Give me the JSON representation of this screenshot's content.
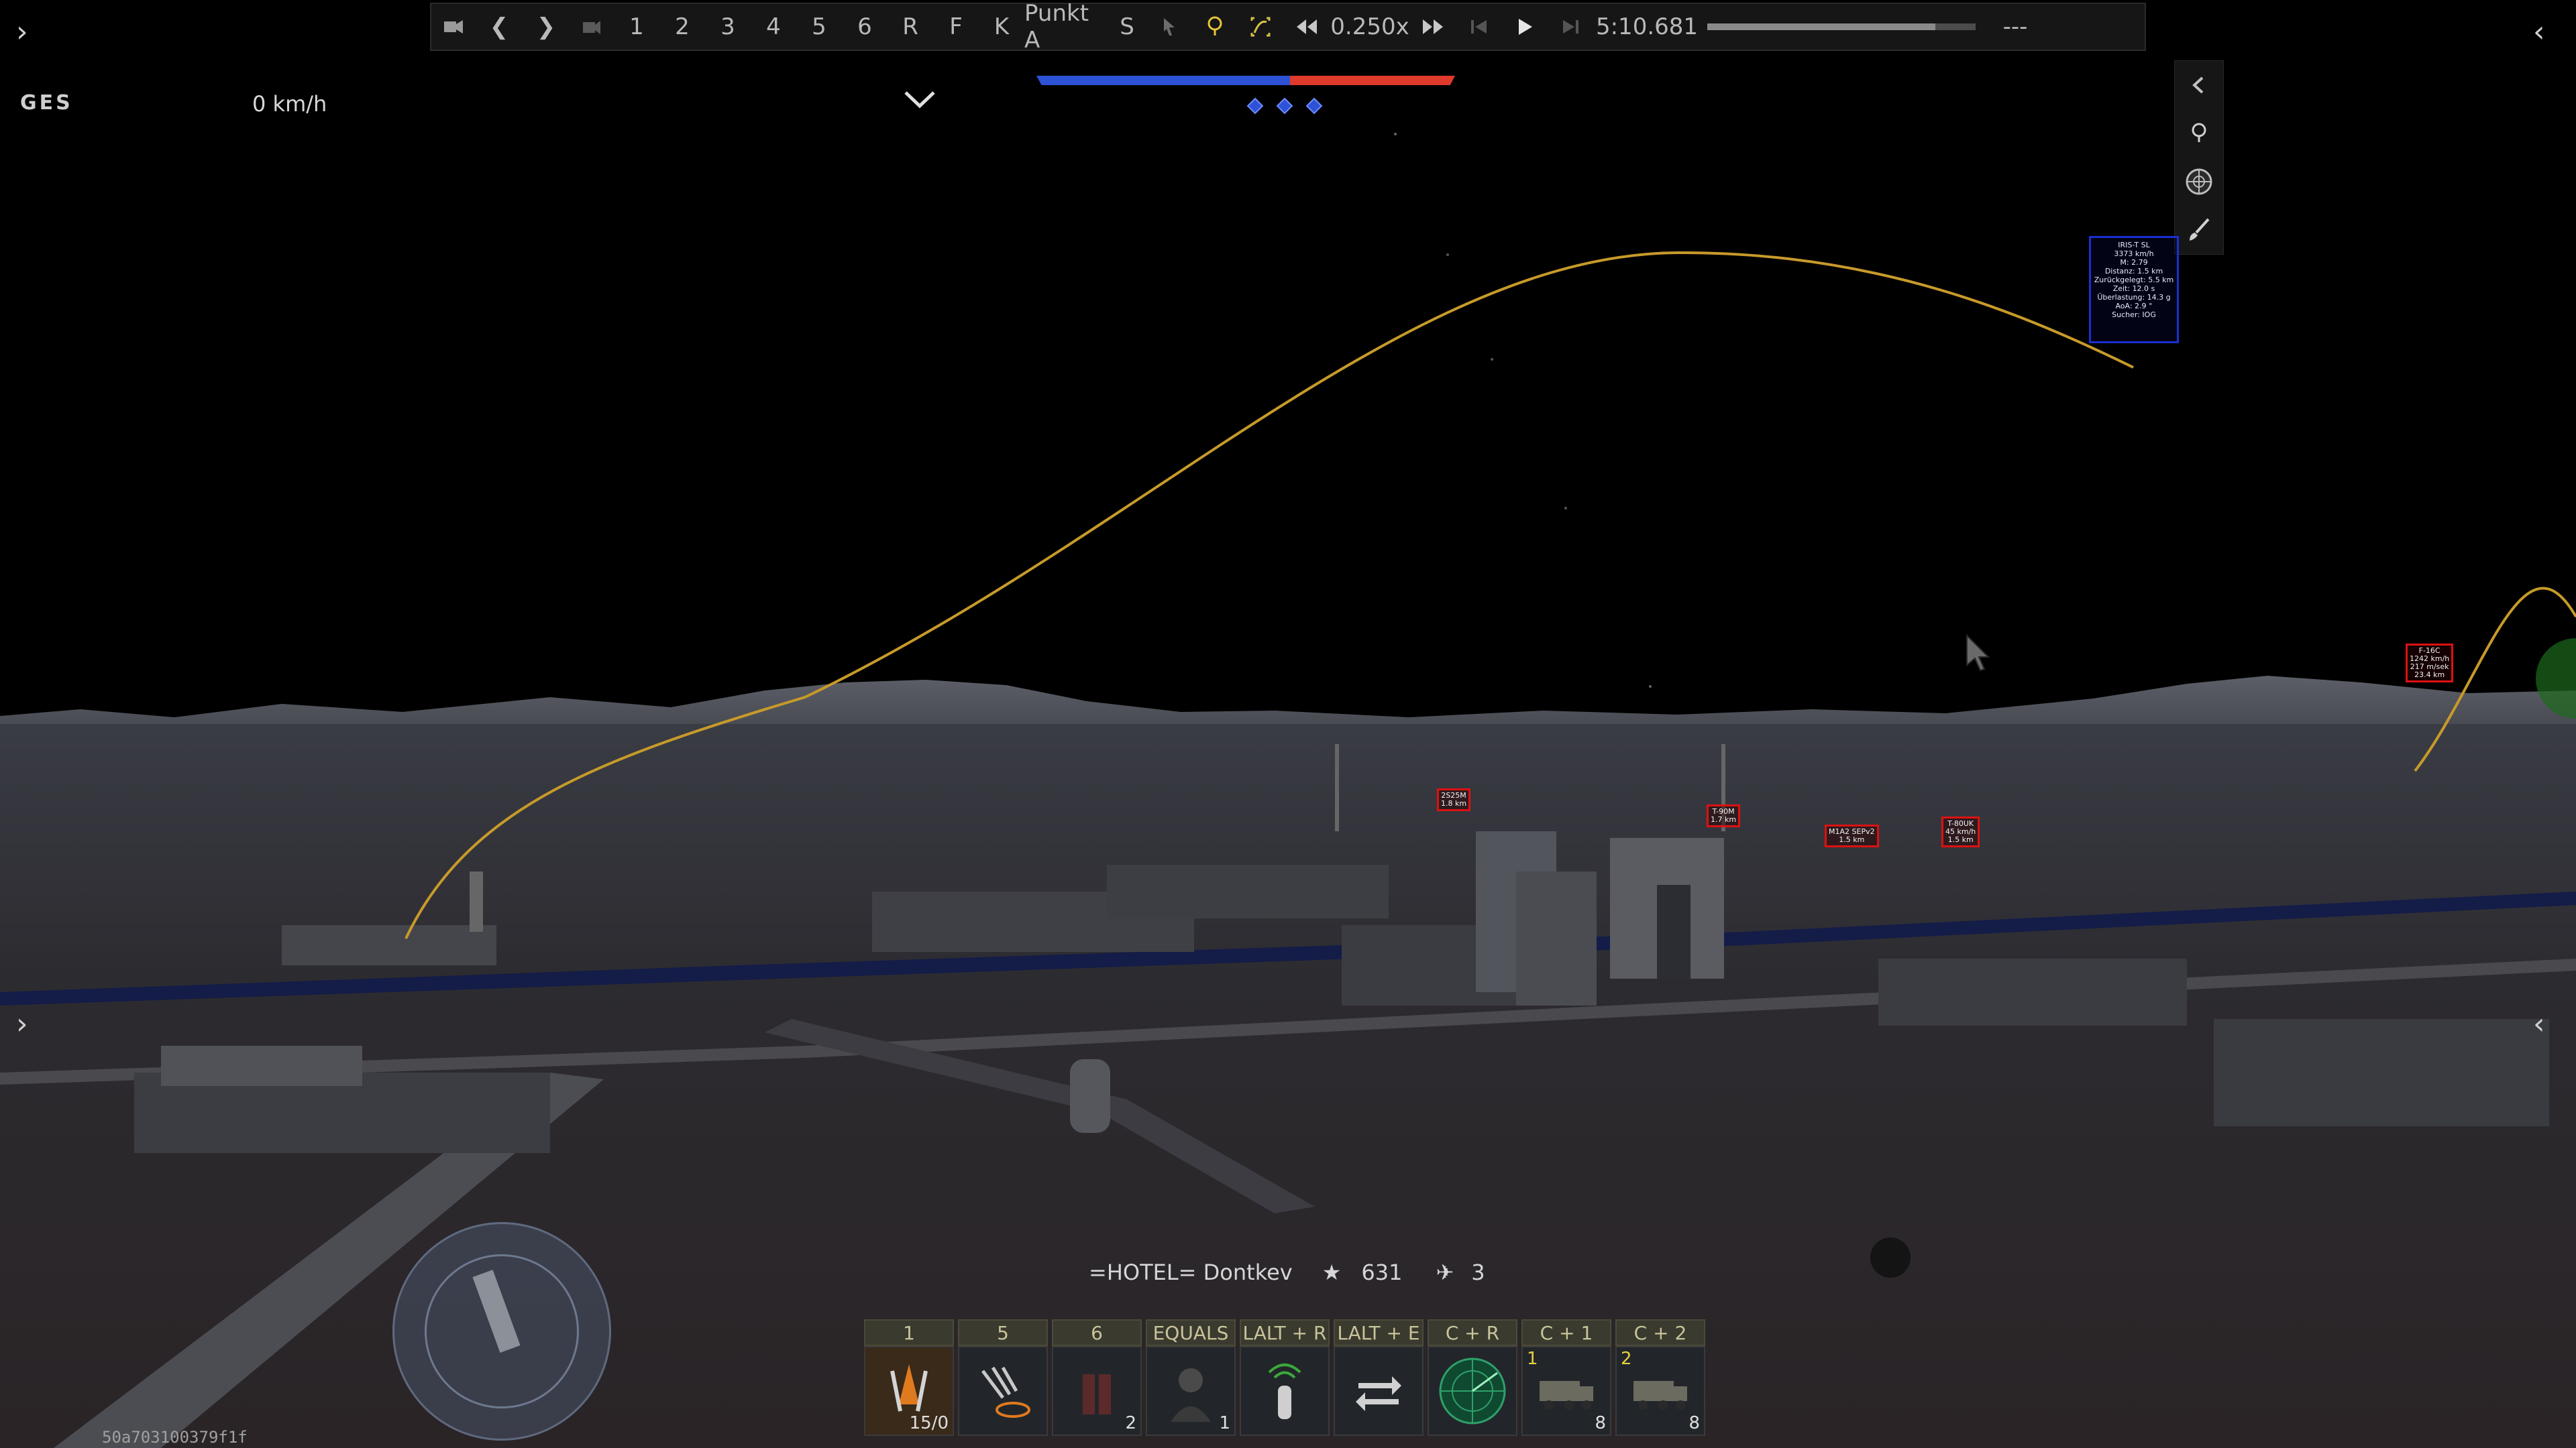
{
  "replay_bar": {
    "cams": [
      "1",
      "2",
      "3",
      "4",
      "5",
      "6",
      "R",
      "F",
      "K",
      "Punkt A",
      "S"
    ],
    "speed": "0.250x",
    "time": "5:10.681",
    "status": "---",
    "progress": 0.85
  },
  "hud": {
    "label": "GES",
    "speed": "0 km/h"
  },
  "missile_info": {
    "lines": [
      "IRIS-T SL",
      "3373 km/h",
      "M: 2.79",
      "Distanz: 1.5 km",
      "Zurückgelegt: 5.5 km",
      "Zeit: 12.0 s",
      "Überlastung: 14.3 g",
      "AoA: 2.9 °",
      "Sucher: IOG"
    ]
  },
  "targets": [
    {
      "lines": [
        "2S25M",
        "1.8 km"
      ]
    },
    {
      "lines": [
        "T-90M",
        "1.7 km"
      ]
    },
    {
      "lines": [
        "M1A2 SEPv2",
        "1.5 km"
      ]
    },
    {
      "lines": [
        "T-80UK",
        "45 km/h",
        "1.5 km"
      ]
    },
    {
      "lines": [
        "F-16C",
        "1242 km/h",
        "217 m/sek",
        "23.4 km"
      ]
    }
  ],
  "player": {
    "name": "=HOTEL= Dontkev",
    "score": "631",
    "aircraft": "3"
  },
  "actions": [
    {
      "key": "1",
      "count": "15/0",
      "top": ""
    },
    {
      "key": "5",
      "count": "",
      "top": ""
    },
    {
      "key": "6",
      "count": "2",
      "top": ""
    },
    {
      "key": "EQUALS",
      "count": "1",
      "top": ""
    },
    {
      "key": "LALT + R",
      "count": "",
      "top": ""
    },
    {
      "key": "LALT + E",
      "count": "",
      "top": ""
    },
    {
      "key": "C + R",
      "count": "",
      "top": ""
    },
    {
      "key": "C + 1",
      "count": "8",
      "top": "1"
    },
    {
      "key": "C + 2",
      "count": "8",
      "top": "2"
    }
  ],
  "session_id": "50a703100379f1f",
  "colors": {
    "team_blue": "#2e52d6",
    "team_red": "#e03a2c",
    "trajectory": "#c79a2a",
    "target_box": "#dd1111",
    "missile_box": "#1b2fcf"
  }
}
